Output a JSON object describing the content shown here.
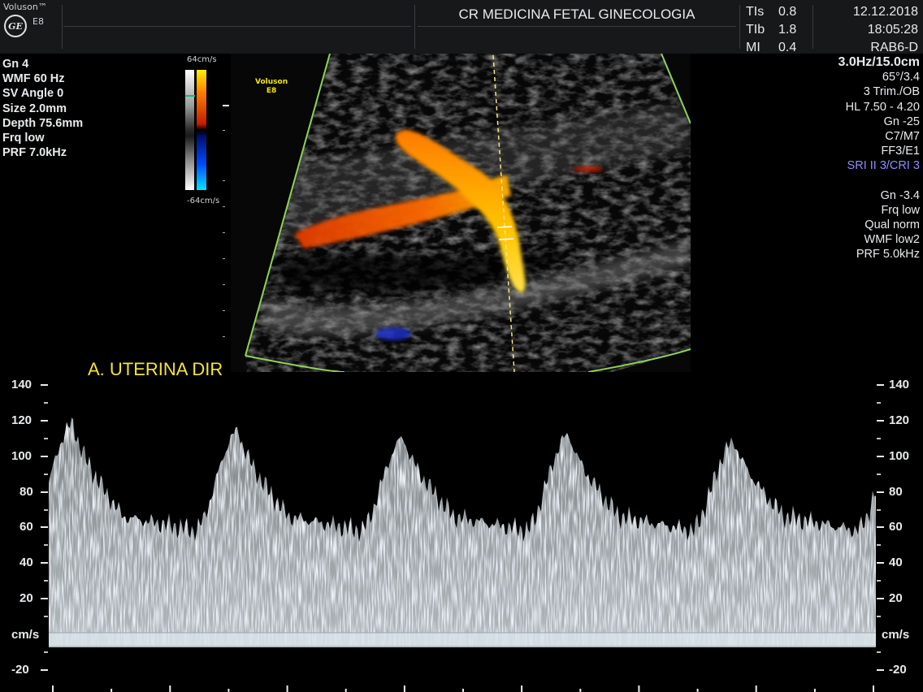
{
  "header": {
    "brand": "Voluson™",
    "logo_text": "GE",
    "model": "E8",
    "institution": "CR MEDICINA FETAL GINECOLOGIA",
    "indices": [
      {
        "key": "TIs",
        "value": "0.8"
      },
      {
        "key": "TIb",
        "value": "1.8"
      },
      {
        "key": "MI",
        "value": "0.4"
      }
    ],
    "date": "12.12.2018",
    "time": "18:05:28",
    "probe": "RAB6-D"
  },
  "left_params": [
    "Gn  4",
    "WMF 60 Hz",
    "SV Angle  0",
    "Size  2.0mm",
    "Depth 75.6mm",
    "Frq low",
    "PRF  7.0kHz"
  ],
  "right_params": {
    "frequency": "3.0Hz/15.0cm",
    "lines_a": [
      "65°/3.4",
      "3 Trim./OB",
      "HL  7.50 - 4.20",
      "Gn -25",
      "C7/M7",
      "FF3/E1"
    ],
    "sri": "SRI II 3/CRI 3",
    "lines_b": [
      "Gn -3.4",
      "Frq low",
      "Qual norm",
      "WMF low2",
      "PRF  5.0kHz"
    ]
  },
  "color_bar": {
    "top_label": "64cm/s",
    "bottom_label": "-64cm/s"
  },
  "bmode": {
    "watermark_line1": "Voluson",
    "watermark_line2": "E8"
  },
  "vessel_label": "A. UTERINA DIR",
  "spectral_axis": {
    "unit": "cm/s",
    "ticks": [
      140,
      120,
      100,
      80,
      60,
      40,
      20,
      -20
    ],
    "tick_labels": [
      "140",
      "120",
      "100",
      "80",
      "60",
      "40",
      "20",
      "-20"
    ],
    "max": 140,
    "min": -20
  },
  "waveform": {
    "peak_velocities": [
      118,
      114,
      110,
      112,
      108
    ],
    "diastolic_velocity": 60,
    "cycles": 5
  },
  "colors": {
    "text": "#e8ebed",
    "label_yellow": "#f3e43a",
    "sri_blue": "#8f8cff",
    "sector_green": "#8fd25a"
  }
}
